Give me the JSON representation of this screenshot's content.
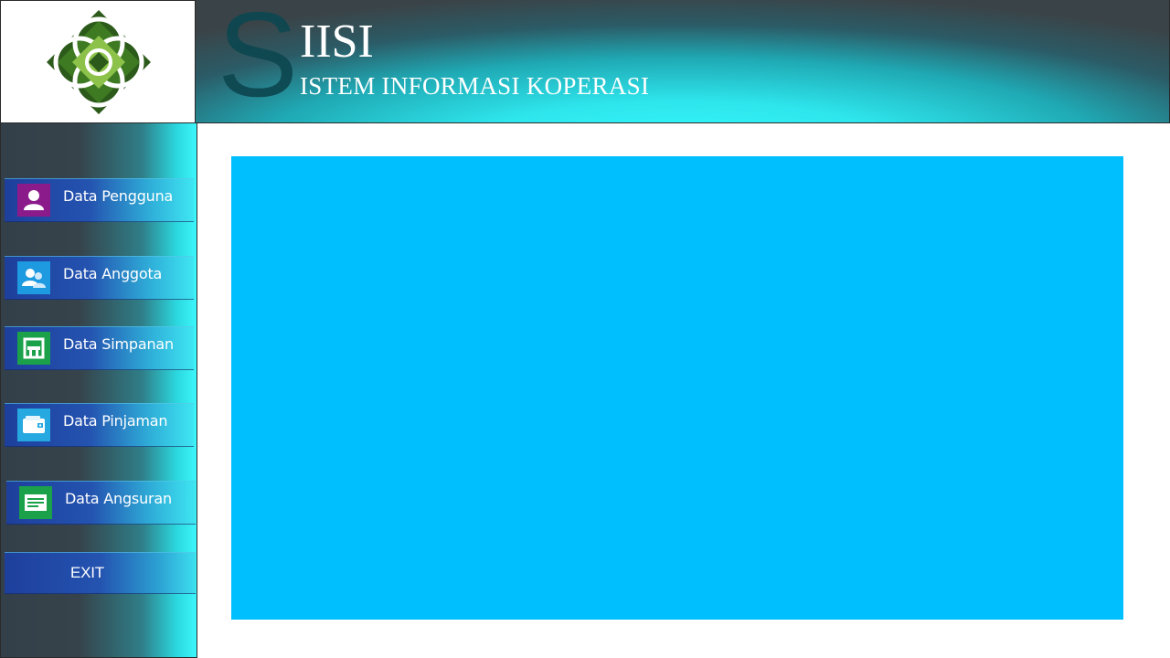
{
  "header": {
    "big_letter": "S",
    "title": "IISI",
    "subtitle": "ISTEM INFORMASI KOPERASI"
  },
  "logo": {
    "icon": "koperasi-diamond-logo"
  },
  "sidebar": {
    "items": [
      {
        "label": "Data Pengguna",
        "icon": "user-icon",
        "icon_bg": "#8b1a8b"
      },
      {
        "label": "Data Anggota",
        "icon": "members-icon",
        "icon_bg": "#1e9ae0"
      },
      {
        "label": "Data Simpanan",
        "icon": "save-icon",
        "icon_bg": "#1aa14a"
      },
      {
        "label": "Data Pinjaman",
        "icon": "wallet-icon",
        "icon_bg": "#26a8e0"
      },
      {
        "label": "Data Angsuran",
        "icon": "document-icon",
        "icon_bg": "#1aa14a"
      }
    ],
    "exit_label": "EXIT"
  },
  "content": {
    "panel_color": "#00bfff"
  }
}
